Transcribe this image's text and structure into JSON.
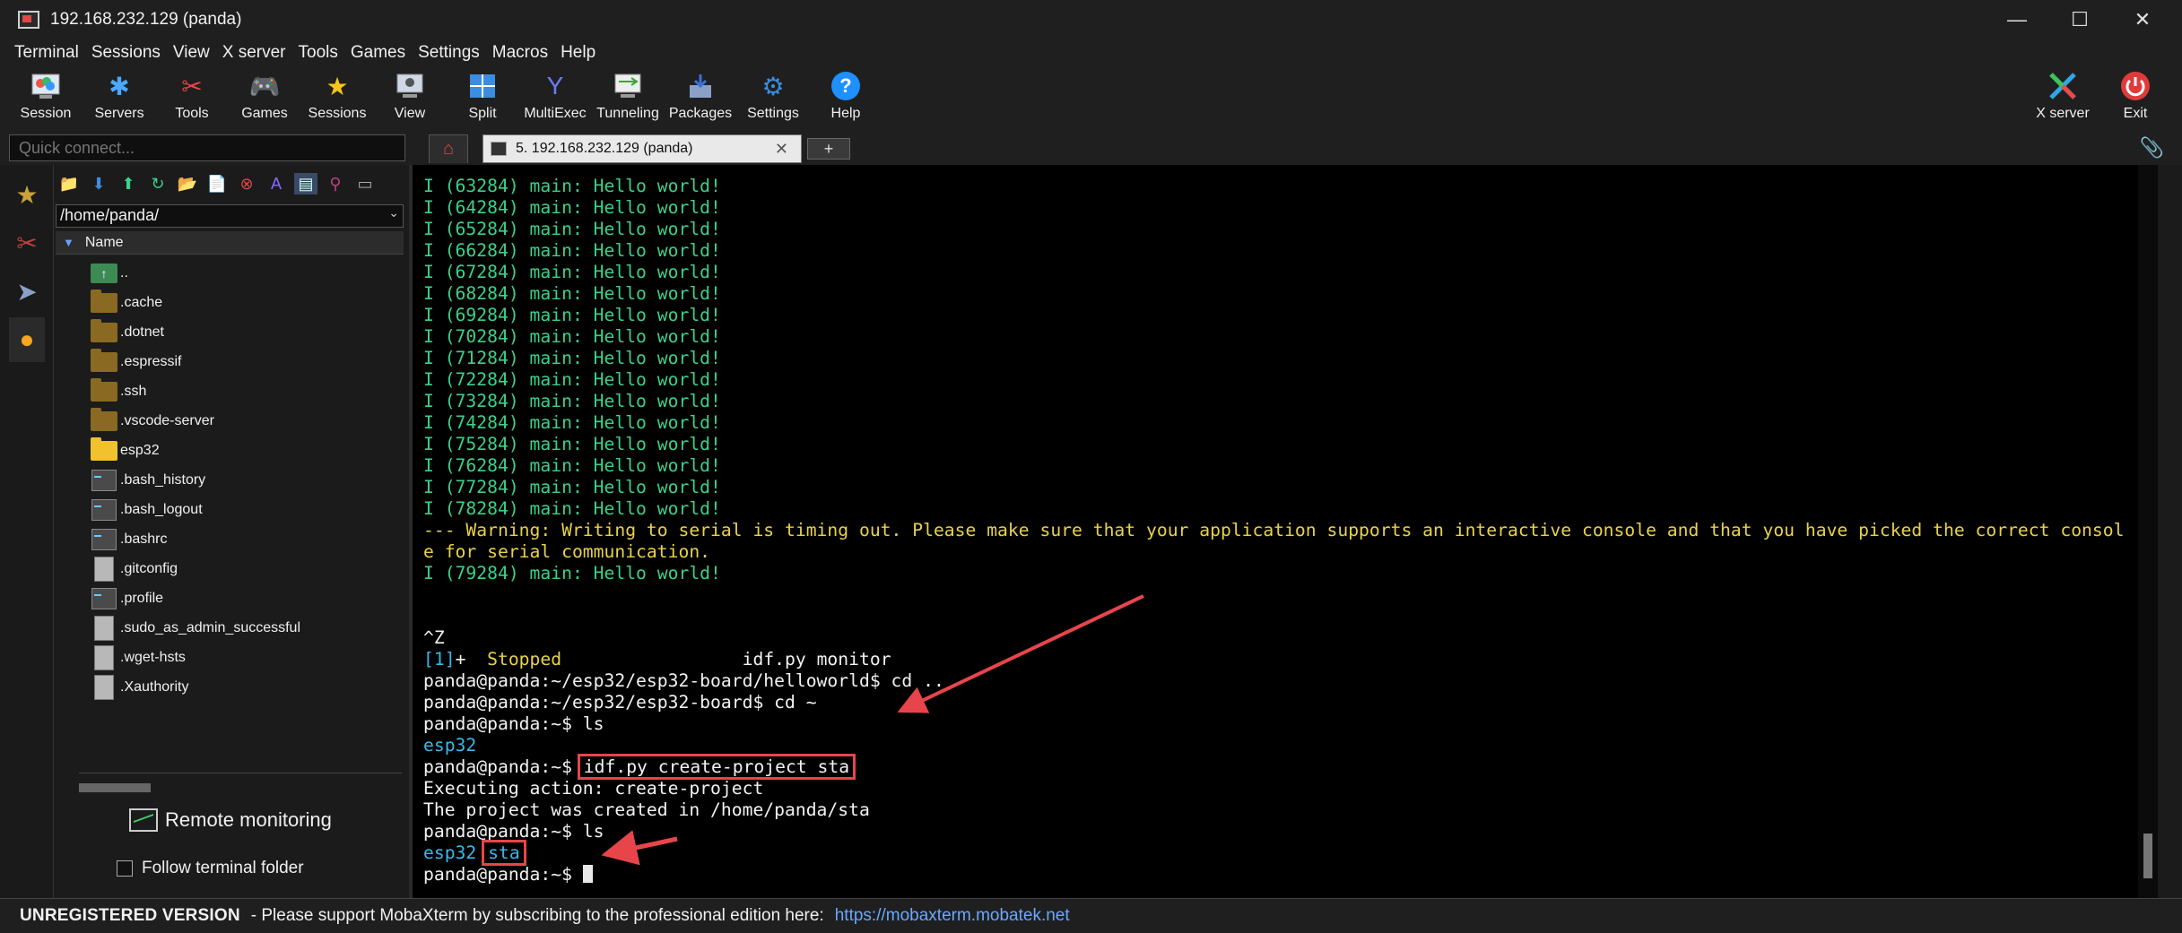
{
  "window": {
    "title": "192.168.232.129 (panda)",
    "controls": {
      "minimize": "—",
      "maximize": "☐",
      "close": "✕"
    }
  },
  "menu": [
    "Terminal",
    "Sessions",
    "View",
    "X server",
    "Tools",
    "Games",
    "Settings",
    "Macros",
    "Help"
  ],
  "toolbar": {
    "left": [
      {
        "label": "Session",
        "icon": "session-icon"
      },
      {
        "label": "Servers",
        "icon": "servers-icon"
      },
      {
        "label": "Tools",
        "icon": "tools-icon"
      },
      {
        "label": "Games",
        "icon": "games-icon"
      },
      {
        "label": "Sessions",
        "icon": "star-icon"
      },
      {
        "label": "View",
        "icon": "view-icon"
      },
      {
        "label": "Split",
        "icon": "split-icon"
      },
      {
        "label": "MultiExec",
        "icon": "multiexec-icon"
      },
      {
        "label": "Tunneling",
        "icon": "tunneling-icon"
      },
      {
        "label": "Packages",
        "icon": "packages-icon"
      },
      {
        "label": "Settings",
        "icon": "settings-icon"
      },
      {
        "label": "Help",
        "icon": "help-icon"
      }
    ],
    "right": [
      {
        "label": "X server",
        "icon": "xserver-icon"
      },
      {
        "label": "Exit",
        "icon": "exit-icon"
      }
    ]
  },
  "quick_connect": {
    "placeholder": "Quick connect..."
  },
  "tabs": {
    "session_tab_label": "5. 192.168.232.129 (panda)",
    "close": "✕",
    "new_tab": "+"
  },
  "sidebar": {
    "path": "/home/panda/",
    "column_header": "Name",
    "files": [
      {
        "name": "..",
        "kind": "up"
      },
      {
        "name": ".cache",
        "kind": "folder"
      },
      {
        "name": ".dotnet",
        "kind": "folder"
      },
      {
        "name": ".espressif",
        "kind": "folder"
      },
      {
        "name": ".ssh",
        "kind": "folder"
      },
      {
        "name": ".vscode-server",
        "kind": "folder"
      },
      {
        "name": "esp32",
        "kind": "folder-bright"
      },
      {
        "name": ".bash_history",
        "kind": "term"
      },
      {
        "name": ".bash_logout",
        "kind": "term"
      },
      {
        "name": ".bashrc",
        "kind": "term"
      },
      {
        "name": ".gitconfig",
        "kind": "doc"
      },
      {
        "name": ".profile",
        "kind": "term"
      },
      {
        "name": ".sudo_as_admin_successful",
        "kind": "doc"
      },
      {
        "name": ".wget-hsts",
        "kind": "doc"
      },
      {
        "name": ".Xauthority",
        "kind": "doc"
      }
    ],
    "remote_monitoring": "Remote monitoring",
    "follow_terminal_folder": "Follow terminal folder"
  },
  "terminal": {
    "lines": [
      {
        "t": "I (63284) main: Hello world!",
        "c": "green"
      },
      {
        "t": "I (64284) main: Hello world!",
        "c": "green"
      },
      {
        "t": "I (65284) main: Hello world!",
        "c": "green"
      },
      {
        "t": "I (66284) main: Hello world!",
        "c": "green"
      },
      {
        "t": "I (67284) main: Hello world!",
        "c": "green"
      },
      {
        "t": "I (68284) main: Hello world!",
        "c": "green"
      },
      {
        "t": "I (69284) main: Hello world!",
        "c": "green"
      },
      {
        "t": "I (70284) main: Hello world!",
        "c": "green"
      },
      {
        "t": "I (71284) main: Hello world!",
        "c": "green"
      },
      {
        "t": "I (72284) main: Hello world!",
        "c": "green"
      },
      {
        "t": "I (73284) main: Hello world!",
        "c": "green"
      },
      {
        "t": "I (74284) main: Hello world!",
        "c": "green"
      },
      {
        "t": "I (75284) main: Hello world!",
        "c": "green"
      },
      {
        "t": "I (76284) main: Hello world!",
        "c": "green"
      },
      {
        "t": "I (77284) main: Hello world!",
        "c": "green"
      },
      {
        "t": "I (78284) main: Hello world!",
        "c": "green"
      },
      {
        "t": "--- Warning: Writing to serial is timing out. Please make sure that your application supports an interactive console and that you have picked the correct consol",
        "c": "yellow"
      },
      {
        "t": "e for serial communication.",
        "c": "yellow"
      },
      {
        "t": "I (79284) main: Hello world!",
        "c": "green"
      },
      {
        "t": "",
        "c": "white"
      },
      {
        "t": "",
        "c": "white"
      },
      {
        "t": "^Z",
        "c": "white"
      },
      {
        "t": "[1]+  Stopped                 idf.py monitor",
        "c": "stopped"
      },
      {
        "t": "panda@panda:~/esp32/esp32-board/helloworld$ cd ..",
        "c": "white"
      },
      {
        "t": "panda@panda:~/esp32/esp32-board$ cd ~",
        "c": "white"
      },
      {
        "t": "panda@panda:~$ ls",
        "c": "white"
      },
      {
        "t": "esp32",
        "c": "cyan"
      },
      {
        "t": "panda@panda:~$ ",
        "c": "white",
        "boxed": "idf.py create-project sta"
      },
      {
        "t": "Executing action: create-project",
        "c": "white"
      },
      {
        "t": "The project was created in /home/panda/sta",
        "c": "white"
      },
      {
        "t": "panda@panda:~$ ls",
        "c": "white"
      },
      {
        "t": "esp32 ",
        "c": "cyan",
        "boxed_cyan": "sta"
      },
      {
        "t": "panda@panda:~$ ",
        "c": "white",
        "cursor": true
      }
    ],
    "colors": {
      "green": "#3bd18a",
      "yellow": "#e8d24a",
      "cyan": "#3ab8e8",
      "white": "#f2f2f2",
      "annotation": "#e8454a"
    }
  },
  "statusbar": {
    "registration": "UNREGISTERED VERSION",
    "message": "-  Please support MobaXterm by subscribing to the professional edition here:",
    "link": "https://mobaxterm.mobatek.net"
  }
}
